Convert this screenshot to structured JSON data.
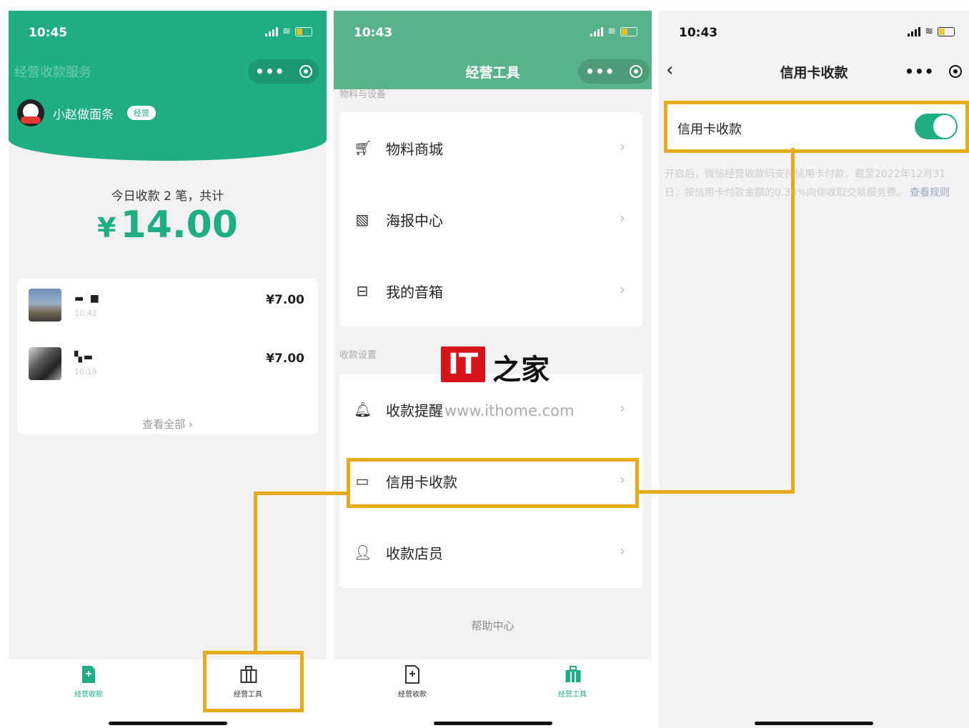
{
  "phone1": {
    "status_time": "10:45",
    "title": "经营收款服务",
    "user_name": "小赵做面条",
    "user_badge": "经营",
    "today_summary": "今日收款 2 笔，共计",
    "currency": "¥",
    "today_amount": "14.00",
    "transactions": [
      {
        "name": "▬ ■",
        "time": "10:42",
        "amount": "¥7.00"
      },
      {
        "name": "▚▬",
        "time": "10:19",
        "amount": "¥7.00"
      }
    ],
    "view_all": "查看全部 ›",
    "tabs": [
      {
        "label": "经营收款",
        "icon": "receipt-icon",
        "active": true
      },
      {
        "label": "经营工具",
        "icon": "toolbox-icon",
        "active": false
      }
    ]
  },
  "phone2": {
    "status_time": "10:43",
    "title": "经营工具",
    "section1_label": "物料与设备",
    "section1_items": [
      {
        "label": "物料商城",
        "icon": "cart-icon"
      },
      {
        "label": "海报中心",
        "icon": "poster-icon"
      },
      {
        "label": "我的音箱",
        "icon": "speaker-icon"
      }
    ],
    "section2_label": "收款设置",
    "section2_items": [
      {
        "label": "收款提醒",
        "icon": "bell-icon"
      },
      {
        "label": "信用卡收款",
        "icon": "card-icon"
      },
      {
        "label": "收款店员",
        "icon": "staff-icon"
      }
    ],
    "help": "帮助中心",
    "watermark": {
      "logo": "IT",
      "name": "之家",
      "url": "www.ithome.com"
    },
    "tabs": [
      {
        "label": "经营收款",
        "icon": "receipt-icon",
        "active": false
      },
      {
        "label": "经营工具",
        "icon": "toolbox-icon",
        "active": true
      }
    ]
  },
  "phone3": {
    "status_time": "10:43",
    "title": "信用卡收款",
    "setting_label": "信用卡收款",
    "toggle_on": true,
    "description": "开启后，微信经营收款码支持信用卡付款，截至2022年12月31日，按信用卡付款金额的0.38%向你收取交易服务费。",
    "rule_link": "查看规则"
  },
  "colors": {
    "brand_green": "#1fae83",
    "highlight": "#e6ac17"
  }
}
